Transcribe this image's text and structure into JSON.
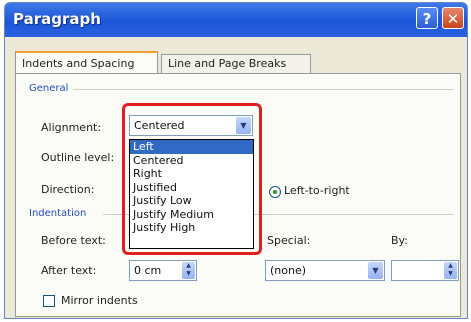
{
  "window": {
    "title": "Paragraph",
    "help_symbol": "?",
    "close_symbol": "✕"
  },
  "tabs": [
    {
      "label": "Indents and Spacing"
    },
    {
      "label": "Line and Page Breaks"
    }
  ],
  "general": {
    "group_label": "General",
    "alignment_label": "Alignment:",
    "alignment_value": "Centered",
    "outline_label": "Outline level:",
    "direction_label": "Direction:",
    "direction_option": "Left-to-right"
  },
  "alignment_options": [
    "Left",
    "Centered",
    "Right",
    "Justified",
    "Justify Low",
    "Justify Medium",
    "Justify High"
  ],
  "indentation": {
    "group_label": "Indentation",
    "before_label": "Before text:",
    "after_label": "After text:",
    "after_value": "0 cm",
    "special_label": "Special:",
    "special_value": "(none)",
    "by_label": "By:",
    "mirror_label": "Mirror indents"
  },
  "icons": {
    "dropdown": "chevron-down-icon",
    "spinner": "spin-arrows-icon"
  }
}
